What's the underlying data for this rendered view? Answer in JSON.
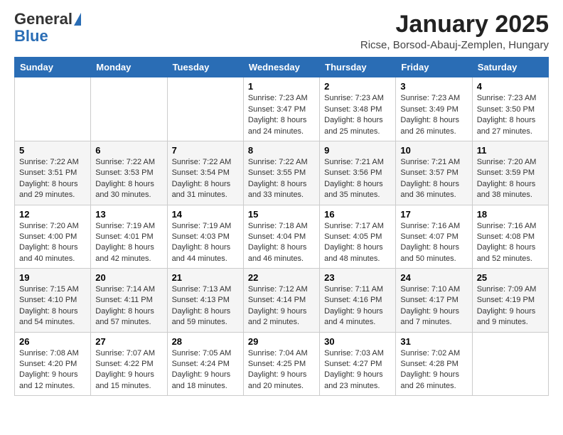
{
  "logo": {
    "general": "General",
    "blue": "Blue"
  },
  "title": "January 2025",
  "location": "Ricse, Borsod-Abauj-Zemplen, Hungary",
  "days_of_week": [
    "Sunday",
    "Monday",
    "Tuesday",
    "Wednesday",
    "Thursday",
    "Friday",
    "Saturday"
  ],
  "weeks": [
    [
      {
        "day": "",
        "info": ""
      },
      {
        "day": "",
        "info": ""
      },
      {
        "day": "",
        "info": ""
      },
      {
        "day": "1",
        "info": "Sunrise: 7:23 AM\nSunset: 3:47 PM\nDaylight: 8 hours\nand 24 minutes."
      },
      {
        "day": "2",
        "info": "Sunrise: 7:23 AM\nSunset: 3:48 PM\nDaylight: 8 hours\nand 25 minutes."
      },
      {
        "day": "3",
        "info": "Sunrise: 7:23 AM\nSunset: 3:49 PM\nDaylight: 8 hours\nand 26 minutes."
      },
      {
        "day": "4",
        "info": "Sunrise: 7:23 AM\nSunset: 3:50 PM\nDaylight: 8 hours\nand 27 minutes."
      }
    ],
    [
      {
        "day": "5",
        "info": "Sunrise: 7:22 AM\nSunset: 3:51 PM\nDaylight: 8 hours\nand 29 minutes."
      },
      {
        "day": "6",
        "info": "Sunrise: 7:22 AM\nSunset: 3:53 PM\nDaylight: 8 hours\nand 30 minutes."
      },
      {
        "day": "7",
        "info": "Sunrise: 7:22 AM\nSunset: 3:54 PM\nDaylight: 8 hours\nand 31 minutes."
      },
      {
        "day": "8",
        "info": "Sunrise: 7:22 AM\nSunset: 3:55 PM\nDaylight: 8 hours\nand 33 minutes."
      },
      {
        "day": "9",
        "info": "Sunrise: 7:21 AM\nSunset: 3:56 PM\nDaylight: 8 hours\nand 35 minutes."
      },
      {
        "day": "10",
        "info": "Sunrise: 7:21 AM\nSunset: 3:57 PM\nDaylight: 8 hours\nand 36 minutes."
      },
      {
        "day": "11",
        "info": "Sunrise: 7:20 AM\nSunset: 3:59 PM\nDaylight: 8 hours\nand 38 minutes."
      }
    ],
    [
      {
        "day": "12",
        "info": "Sunrise: 7:20 AM\nSunset: 4:00 PM\nDaylight: 8 hours\nand 40 minutes."
      },
      {
        "day": "13",
        "info": "Sunrise: 7:19 AM\nSunset: 4:01 PM\nDaylight: 8 hours\nand 42 minutes."
      },
      {
        "day": "14",
        "info": "Sunrise: 7:19 AM\nSunset: 4:03 PM\nDaylight: 8 hours\nand 44 minutes."
      },
      {
        "day": "15",
        "info": "Sunrise: 7:18 AM\nSunset: 4:04 PM\nDaylight: 8 hours\nand 46 minutes."
      },
      {
        "day": "16",
        "info": "Sunrise: 7:17 AM\nSunset: 4:05 PM\nDaylight: 8 hours\nand 48 minutes."
      },
      {
        "day": "17",
        "info": "Sunrise: 7:16 AM\nSunset: 4:07 PM\nDaylight: 8 hours\nand 50 minutes."
      },
      {
        "day": "18",
        "info": "Sunrise: 7:16 AM\nSunset: 4:08 PM\nDaylight: 8 hours\nand 52 minutes."
      }
    ],
    [
      {
        "day": "19",
        "info": "Sunrise: 7:15 AM\nSunset: 4:10 PM\nDaylight: 8 hours\nand 54 minutes."
      },
      {
        "day": "20",
        "info": "Sunrise: 7:14 AM\nSunset: 4:11 PM\nDaylight: 8 hours\nand 57 minutes."
      },
      {
        "day": "21",
        "info": "Sunrise: 7:13 AM\nSunset: 4:13 PM\nDaylight: 8 hours\nand 59 minutes."
      },
      {
        "day": "22",
        "info": "Sunrise: 7:12 AM\nSunset: 4:14 PM\nDaylight: 9 hours\nand 2 minutes."
      },
      {
        "day": "23",
        "info": "Sunrise: 7:11 AM\nSunset: 4:16 PM\nDaylight: 9 hours\nand 4 minutes."
      },
      {
        "day": "24",
        "info": "Sunrise: 7:10 AM\nSunset: 4:17 PM\nDaylight: 9 hours\nand 7 minutes."
      },
      {
        "day": "25",
        "info": "Sunrise: 7:09 AM\nSunset: 4:19 PM\nDaylight: 9 hours\nand 9 minutes."
      }
    ],
    [
      {
        "day": "26",
        "info": "Sunrise: 7:08 AM\nSunset: 4:20 PM\nDaylight: 9 hours\nand 12 minutes."
      },
      {
        "day": "27",
        "info": "Sunrise: 7:07 AM\nSunset: 4:22 PM\nDaylight: 9 hours\nand 15 minutes."
      },
      {
        "day": "28",
        "info": "Sunrise: 7:05 AM\nSunset: 4:24 PM\nDaylight: 9 hours\nand 18 minutes."
      },
      {
        "day": "29",
        "info": "Sunrise: 7:04 AM\nSunset: 4:25 PM\nDaylight: 9 hours\nand 20 minutes."
      },
      {
        "day": "30",
        "info": "Sunrise: 7:03 AM\nSunset: 4:27 PM\nDaylight: 9 hours\nand 23 minutes."
      },
      {
        "day": "31",
        "info": "Sunrise: 7:02 AM\nSunset: 4:28 PM\nDaylight: 9 hours\nand 26 minutes."
      },
      {
        "day": "",
        "info": ""
      }
    ]
  ]
}
